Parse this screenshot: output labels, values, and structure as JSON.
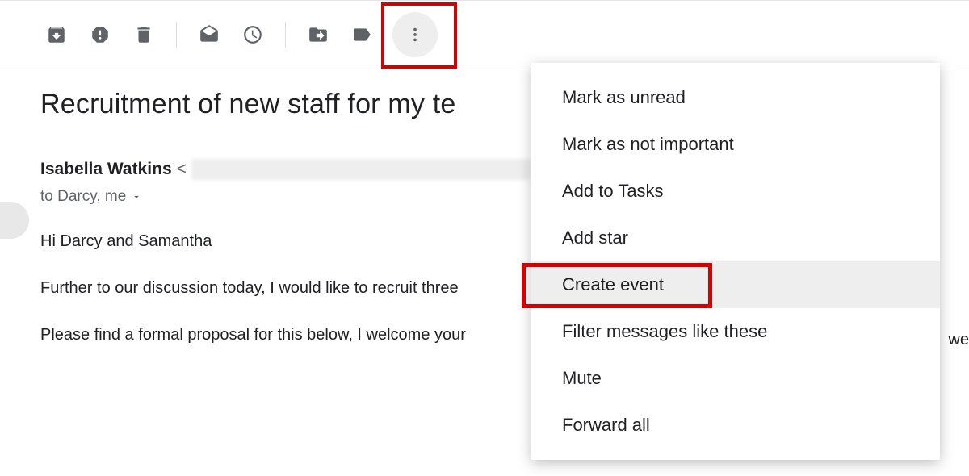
{
  "toolbar": {
    "icons": [
      "archive",
      "spam",
      "delete",
      "unread",
      "snooze",
      "move",
      "label",
      "more"
    ]
  },
  "email": {
    "subject": "Recruitment of new staff for my te",
    "sender_name": "Isabella Watkins",
    "to_line": "to Darcy, me",
    "body_line1": "Hi Darcy and Samantha",
    "body_line2": "Further to our discussion today, I would like to recruit three ",
    "body_line3": "Please find a formal proposal for this below, I welcome your",
    "fragment_right": "we"
  },
  "menu": {
    "items": [
      "Mark as unread",
      "Mark as not important",
      "Add to Tasks",
      "Add star",
      "Create event",
      "Filter messages like these",
      "Mute",
      "Forward all"
    ],
    "highlighted_index": 4
  }
}
